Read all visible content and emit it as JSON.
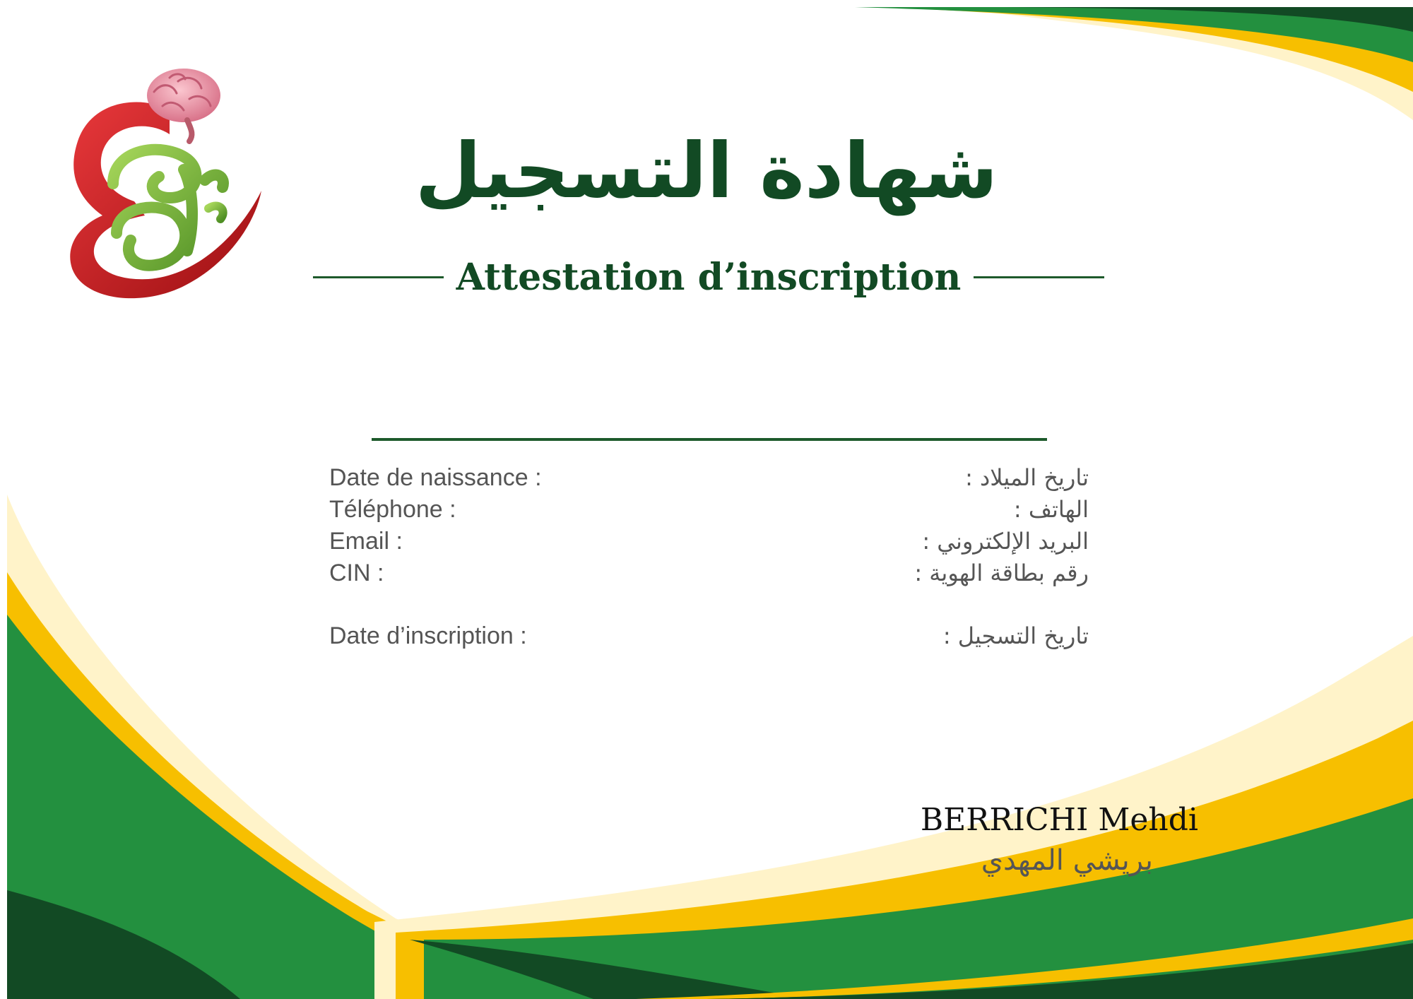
{
  "certificate": {
    "title_ar": "شهادة التسجيل",
    "title_fr": "Attestation d’inscription",
    "student_name": ""
  },
  "fields": [
    {
      "label_fr": "Date de naissance :",
      "label_ar": "تاريخ الميلاد :"
    },
    {
      "label_fr": "Téléphone :",
      "label_ar": "الهاتف :"
    },
    {
      "label_fr": "Email :",
      "label_ar": "البريد الإلكتروني :"
    },
    {
      "label_fr": "CIN :",
      "label_ar": "رقم بطاقة الهوية :"
    },
    {
      "label_fr": "Date d’inscription :",
      "label_ar": "تاريخ التسجيل :"
    }
  ],
  "signatory": {
    "name_fr": "BERRICHI Mehdi",
    "name_ar": "بريشي المهدي"
  },
  "logo": {
    "text_ar": "جنوع",
    "icon": "brain-heart-logo"
  },
  "colors": {
    "dark_green": "#124a24",
    "green": "#23903f",
    "yellow": "#f7bf00",
    "cream": "#fff3c9",
    "logo_red": "#d0191d",
    "logo_green": "#7ab33a",
    "brain_pink": "#f2a0ad"
  }
}
